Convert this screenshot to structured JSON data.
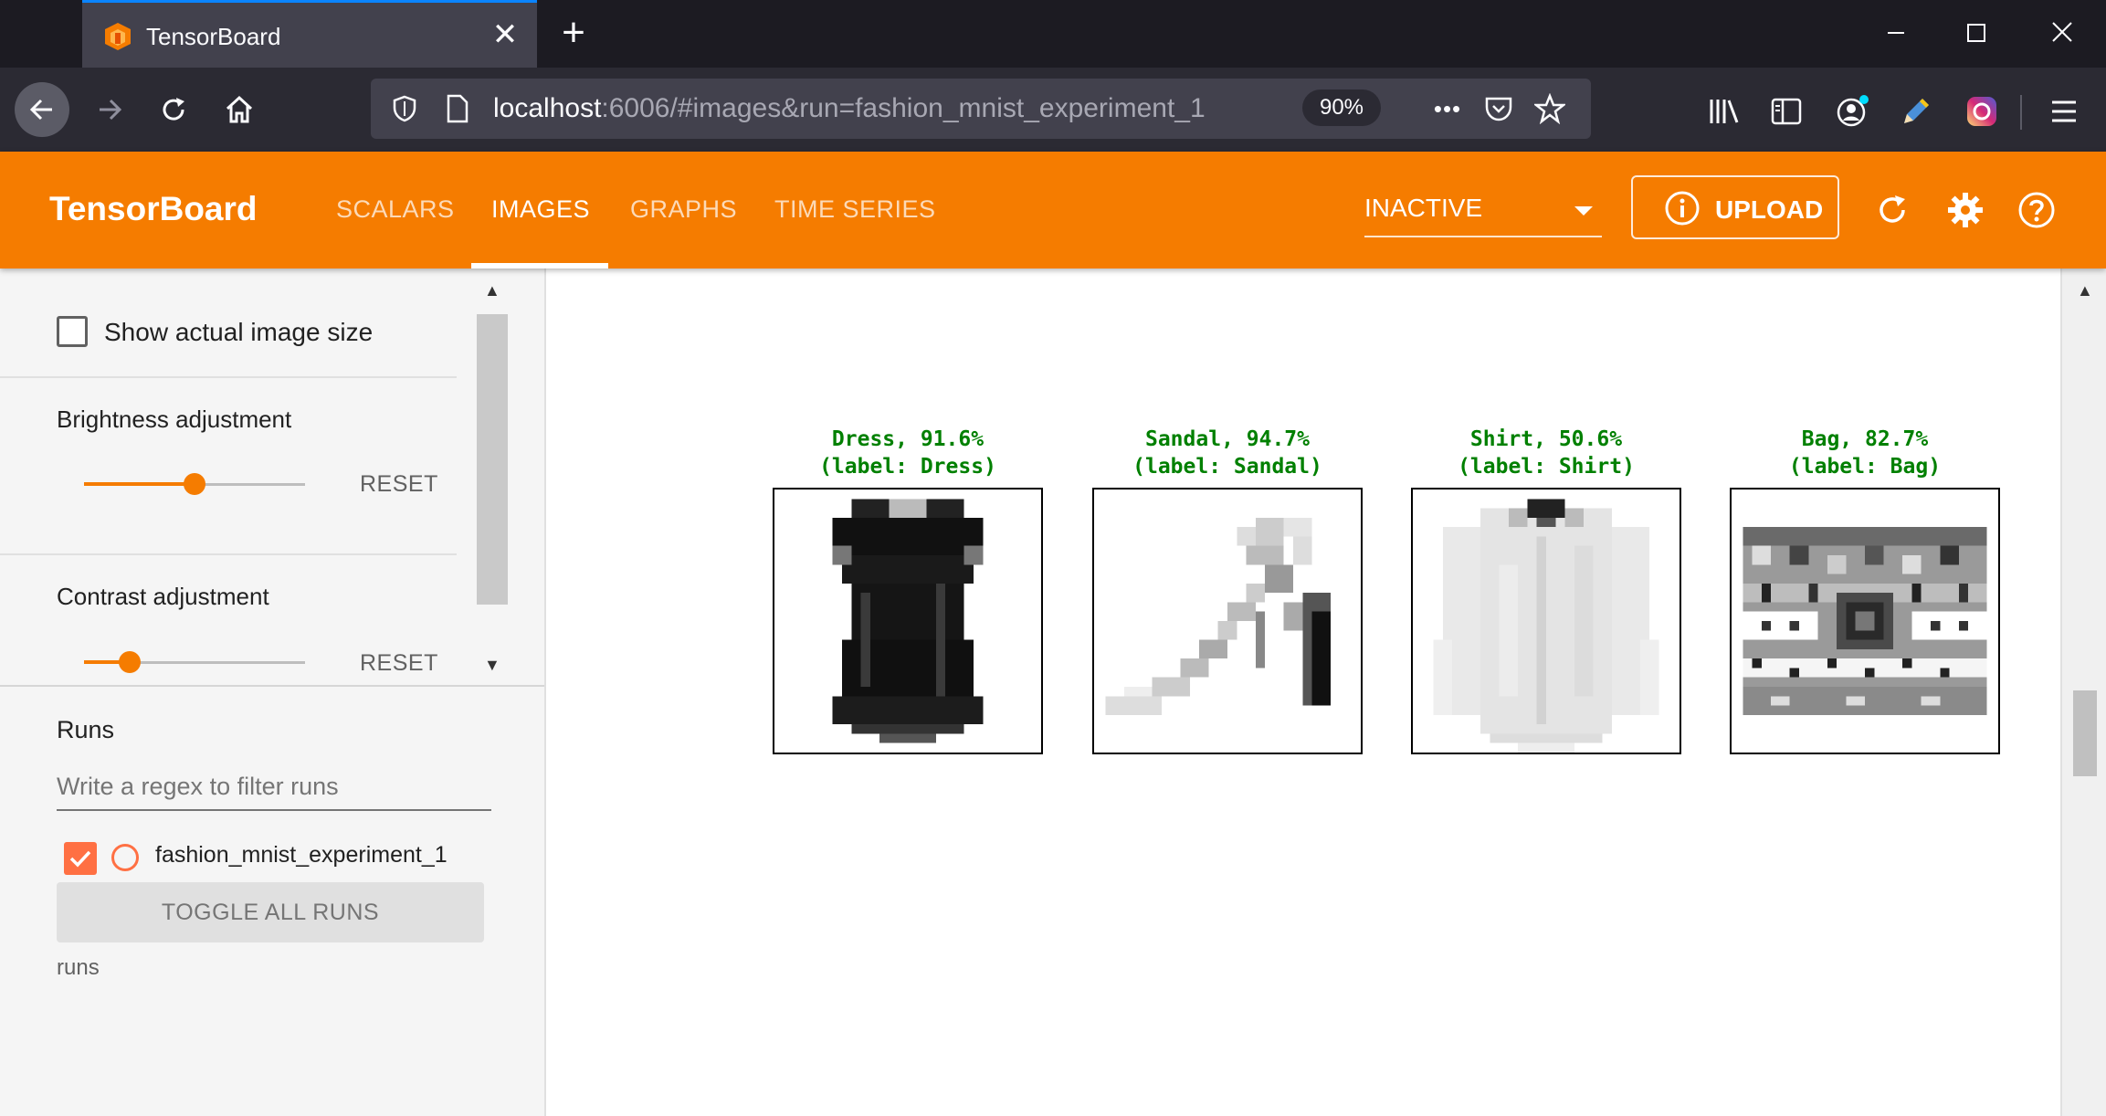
{
  "browser": {
    "tab_title": "TensorBoard",
    "url_host": "localhost",
    "url_rest": ":6006/#images&run=fashion_mnist_experiment_1",
    "zoom": "90%",
    "menu_glyph": "•••"
  },
  "tensorboard": {
    "brand": "TensorBoard",
    "tabs": [
      "SCALARS",
      "IMAGES",
      "GRAPHS",
      "TIME SERIES"
    ],
    "active_tab": "IMAGES",
    "run_status": "INACTIVE",
    "upload_label": "UPLOAD",
    "colors": {
      "header": "#f57c00",
      "accent": "#f57c00",
      "run": "#ff7043",
      "caption": "#008000"
    }
  },
  "sidebar": {
    "show_actual_size_label": "Show actual image size",
    "show_actual_size_checked": false,
    "brightness": {
      "label": "Brightness adjustment",
      "reset": "RESET",
      "level": 0.5
    },
    "contrast": {
      "label": "Contrast adjustment",
      "reset": "RESET",
      "level": 0.2
    },
    "runs_heading": "Runs",
    "runs_filter_placeholder": "Write a regex to filter runs",
    "run_name": "fashion_mnist_experiment_1",
    "toggle_all_label": "TOGGLE ALL RUNS",
    "runs_footer": "runs"
  },
  "samples": [
    {
      "prediction": "Dress, 91.6%",
      "label": "(label: Dress)",
      "item": "dress"
    },
    {
      "prediction": "Sandal, 94.7%",
      "label": "(label: Sandal)",
      "item": "sandal"
    },
    {
      "prediction": "Shirt, 50.6%",
      "label": "(label: Shirt)",
      "item": "shirt"
    },
    {
      "prediction": "Bag, 82.7%",
      "label": "(label: Bag)",
      "item": "bag"
    }
  ]
}
